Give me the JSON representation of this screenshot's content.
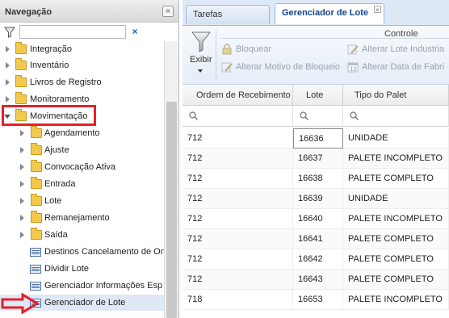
{
  "nav": {
    "title": "Navegação",
    "collapse_icon": "double-chevron-left-icon",
    "filter": {
      "value": "",
      "placeholder": "",
      "clear_label": "×"
    },
    "items": [
      {
        "label": "Integração",
        "type": "folder",
        "expanded": false
      },
      {
        "label": "Inventário",
        "type": "folder",
        "expanded": false
      },
      {
        "label": "Livros de Registro",
        "type": "folder",
        "expanded": false
      },
      {
        "label": "Monitoramento",
        "type": "folder",
        "expanded": false
      },
      {
        "label": "Movimentação",
        "type": "folder",
        "expanded": true
      },
      {
        "label": "Agendamento",
        "type": "folder",
        "expanded": false
      },
      {
        "label": "Ajuste",
        "type": "folder",
        "expanded": false
      },
      {
        "label": "Convocação Ativa",
        "type": "folder",
        "expanded": false
      },
      {
        "label": "Entrada",
        "type": "folder",
        "expanded": false
      },
      {
        "label": "Lote",
        "type": "folder",
        "expanded": false
      },
      {
        "label": "Remanejamento",
        "type": "folder",
        "expanded": false
      },
      {
        "label": "Saída",
        "type": "folder",
        "expanded": false
      },
      {
        "label": "Destinos Cancelamento de On",
        "type": "leaf"
      },
      {
        "label": "Dividir Lote",
        "type": "leaf"
      },
      {
        "label": "Gerenciador Informações Esp",
        "type": "leaf"
      },
      {
        "label": "Gerenciador de Lote",
        "type": "leaf",
        "selected": true
      }
    ]
  },
  "tabs": [
    {
      "label": "Tarefas Principais",
      "active": false
    },
    {
      "label": "Gerenciador de Lote",
      "active": true,
      "close_label": "×"
    }
  ],
  "toolbar": {
    "exibir_label": "Exibir",
    "group_label": "Controle",
    "buttons": [
      {
        "label": "Bloquear",
        "enabled": false
      },
      {
        "label": "Alterar Motivo de Bloqueio",
        "enabled": false
      },
      {
        "label": "Alterar Lote Industria",
        "enabled": false
      },
      {
        "label": "Alterar Data de Fabri",
        "enabled": false
      }
    ]
  },
  "grid": {
    "columns": [
      "Ordem de Recebimento",
      "Lote",
      "Tipo do Palet"
    ],
    "rows": [
      [
        "712",
        "16636",
        "UNIDADE"
      ],
      [
        "712",
        "16637",
        "PALETE INCOMPLETO"
      ],
      [
        "712",
        "16638",
        "PALETE COMPLETO"
      ],
      [
        "712",
        "16639",
        "UNIDADE"
      ],
      [
        "712",
        "16640",
        "PALETE INCOMPLETO"
      ],
      [
        "712",
        "16641",
        "PALETE COMPLETO"
      ],
      [
        "712",
        "16642",
        "PALETE COMPLETO"
      ],
      [
        "712",
        "16643",
        "PALETE COMPLETO"
      ],
      [
        "718",
        "16653",
        "PALETE INCOMPLETO"
      ]
    ]
  },
  "colors": {
    "highlight": "#e3202a",
    "accent": "#15428b"
  }
}
